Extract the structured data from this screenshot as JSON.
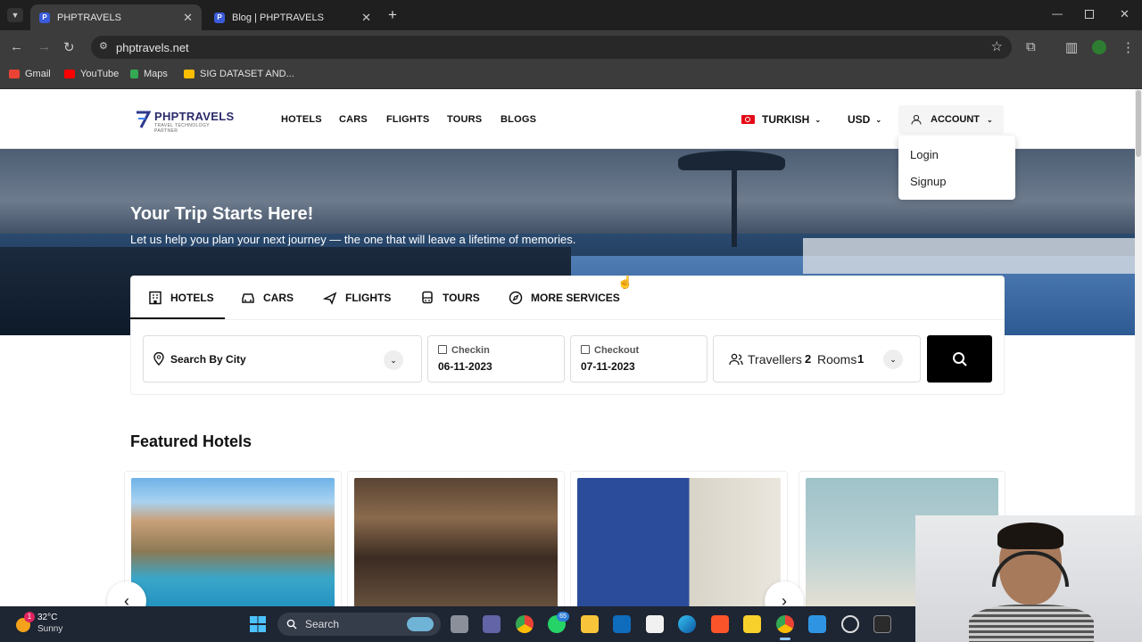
{
  "browser": {
    "tabs": [
      {
        "title": "PHPTRAVELS",
        "active": true
      },
      {
        "title": "Blog | PHPTRAVELS",
        "active": false
      }
    ],
    "new_tab_symbol": "+",
    "url": "phptravels.net",
    "bookmarks": [
      {
        "label": "Gmail",
        "color": "#ea4335"
      },
      {
        "label": "YouTube",
        "color": "#ff0000"
      },
      {
        "label": "Maps",
        "color": "#34a853"
      },
      {
        "label": "SIG DATASET AND...",
        "color": "#fbbc04"
      }
    ]
  },
  "site": {
    "logo": {
      "name": "PHPTRAVELS",
      "tagline": "TRAVEL TECHNOLOGY PARTNER"
    },
    "nav": [
      "HOTELS",
      "CARS",
      "FLIGHTS",
      "TOURS",
      "BLOGS"
    ],
    "language": "TURKISH",
    "currency": "USD",
    "account": "ACCOUNT",
    "account_menu": [
      "Login",
      "Signup"
    ]
  },
  "hero": {
    "title": "Your Trip Starts Here!",
    "subtitle": "Let us help you plan your next journey — the one that will leave a lifetime of memories."
  },
  "search": {
    "tabs": [
      "HOTELS",
      "CARS",
      "FLIGHTS",
      "TOURS",
      "MORE SERVICES"
    ],
    "active_tab": "HOTELS",
    "city_placeholder": "Search By City",
    "checkin_label": "Checkin",
    "checkin_value": "06-11-2023",
    "checkout_label": "Checkout",
    "checkout_value": "07-11-2023",
    "travellers_label": "Travellers",
    "travellers_value": "2",
    "rooms_label": "Rooms",
    "rooms_value": "1"
  },
  "featured": {
    "title": "Featured Hotels",
    "prev_symbol": "‹",
    "next_symbol": "›"
  },
  "taskbar": {
    "weather_temp": "32°C",
    "weather_desc": "Sunny",
    "weather_badge": "1",
    "search_label": "Search",
    "whatsapp_badge": "65"
  },
  "colors": {
    "accent": "#000000",
    "logo_blue": "#2d3a8c",
    "taskbar": "#1e2533"
  }
}
